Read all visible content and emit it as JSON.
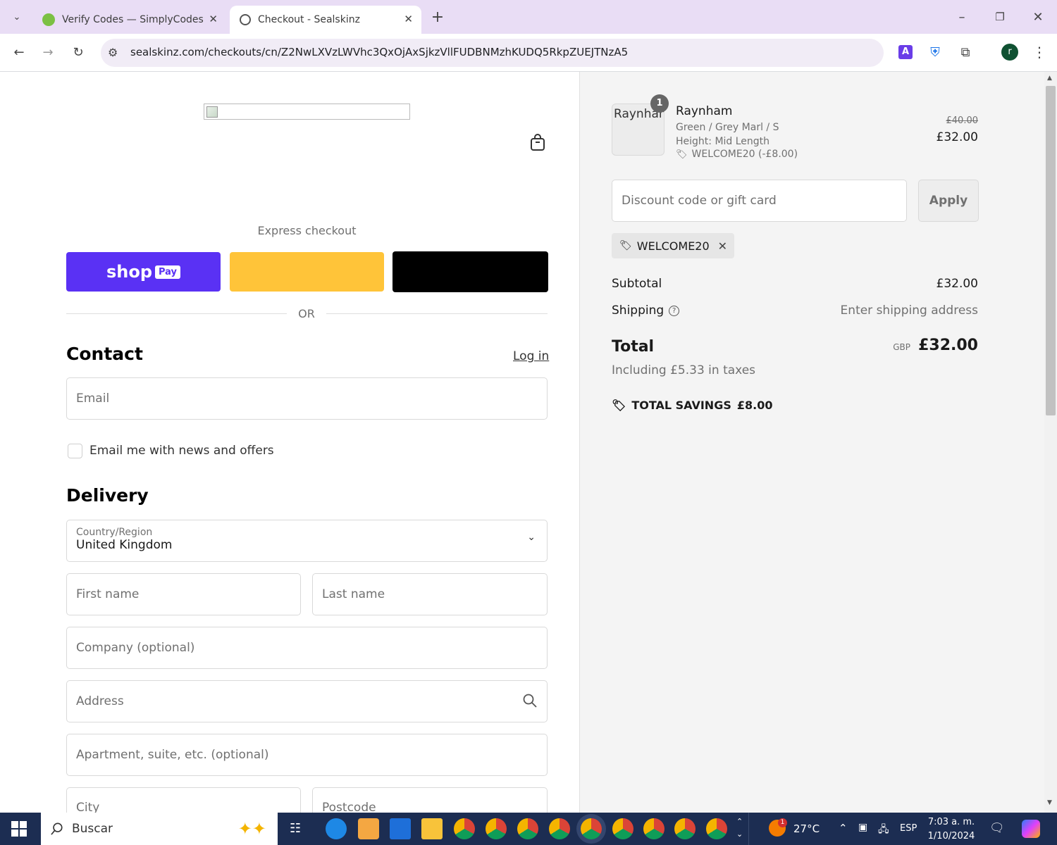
{
  "browser": {
    "tabs": [
      {
        "title": "Verify Codes — SimplyCodes",
        "active": false
      },
      {
        "title": "Checkout - Sealskinz",
        "active": true
      }
    ],
    "url": "sealskinz.com/checkouts/cn/Z2NwLXVzLWVhc3QxOjAxSjkzVllFUDBNMzhKUDQ5RkpZUEJTNzA5",
    "profile_initial": "r"
  },
  "checkout": {
    "express_label": "Express checkout",
    "shop_pay": "shop",
    "shop_pay_badge": "Pay",
    "or_label": "OR",
    "contact_heading": "Contact",
    "login_link": "Log in",
    "email_placeholder": "Email",
    "news_checkbox_label": "Email me with news and offers",
    "news_checked": false,
    "delivery_heading": "Delivery",
    "country_label": "Country/Region",
    "country_value": "United Kingdom",
    "first_name": "First name",
    "last_name": "Last name",
    "company": "Company (optional)",
    "address": "Address",
    "apartment": "Apartment, suite, etc. (optional)",
    "city": "City",
    "postcode": "Postcode"
  },
  "summary": {
    "product": {
      "image_alt": "Raynham",
      "quantity": "1",
      "name": "Raynham",
      "variant": "Green / Grey Marl / S",
      "height": "Height: Mid Length",
      "discount": "WELCOME20 (-£8.00)",
      "original_price": "£40.00",
      "price": "£32.00"
    },
    "discount_placeholder": "Discount code or gift card",
    "apply_label": "Apply",
    "applied_code": "WELCOME20",
    "subtotal_label": "Subtotal",
    "subtotal_value": "£32.00",
    "shipping_label": "Shipping",
    "shipping_value": "Enter shipping address",
    "total_label": "Total",
    "currency": "GBP",
    "total_value": "£32.00",
    "taxes": "Including £5.33 in taxes",
    "savings_label": "TOTAL SAVINGS",
    "savings_value": "£8.00"
  },
  "taskbar": {
    "search": "Buscar",
    "weather": "27°C",
    "weather_badge": "1",
    "lang": "ESP",
    "time": "7:03 a. m.",
    "date": "1/10/2024"
  },
  "colors": {
    "shop_pay": "#5a31f4",
    "paypal": "#ffc439",
    "gpay": "#000000",
    "tabbar": "#e9ddf5",
    "taskbar": "#1c2d52"
  }
}
